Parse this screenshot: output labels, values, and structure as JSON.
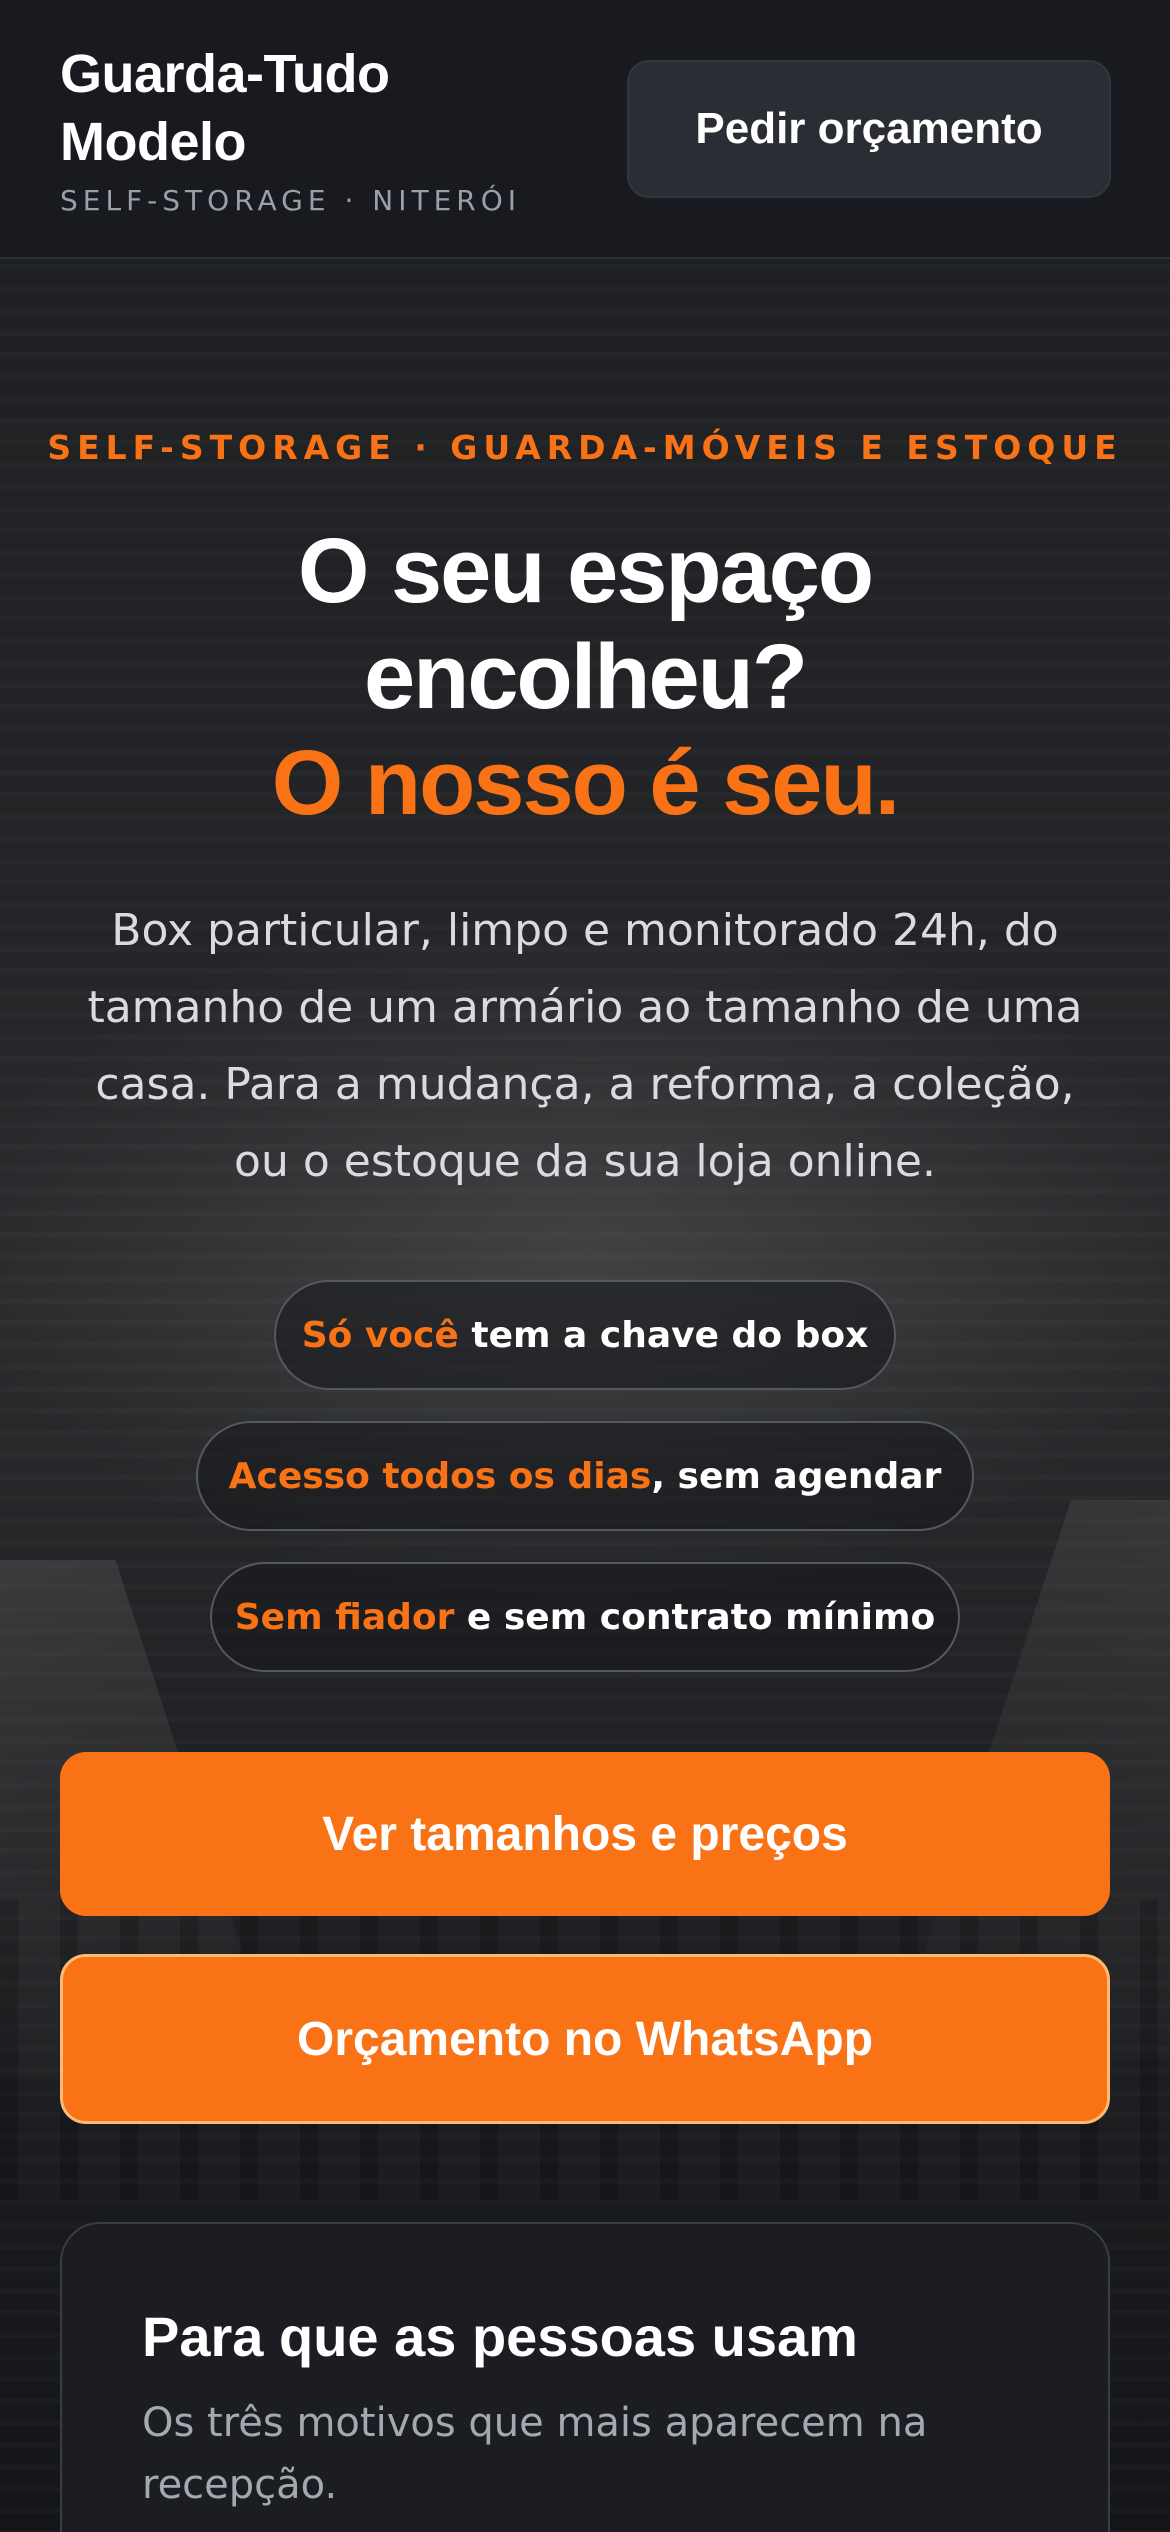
{
  "header": {
    "brand_name": "Guarda-Tudo Modelo",
    "brand_tagline": "SELF-STORAGE · NITERÓI",
    "quote_button": "Pedir orçamento"
  },
  "hero": {
    "eyebrow": "SELF-STORAGE · GUARDA-MÓVEIS E ESTOQUE",
    "headline_line1": "O seu espaço",
    "headline_line2": "encolheu?",
    "headline_accent": "O nosso é seu.",
    "lead": "Box particular, limpo e monitorado 24h, do tamanho de um armário ao tamanho de uma casa. Para a mudança, a reforma, a coleção, ou o estoque da sua loja online.",
    "features": [
      {
        "highlight": "Só você",
        "rest": " tem a chave do box"
      },
      {
        "highlight": "Acesso todos os dias",
        "rest": ", sem agendar"
      },
      {
        "highlight": "Sem fiador",
        "rest": " e sem contrato mínimo"
      }
    ],
    "cta_primary": "Ver tamanhos e preços",
    "cta_secondary": "Orçamento no WhatsApp"
  },
  "uses": {
    "title": "Para que as pessoas usam",
    "subtitle": "Os três motivos que mais aparecem na recepção."
  },
  "colors": {
    "accent": "#f97316",
    "background": "#1e1f22",
    "header": "#181a1f",
    "card": "#1b1d22"
  }
}
